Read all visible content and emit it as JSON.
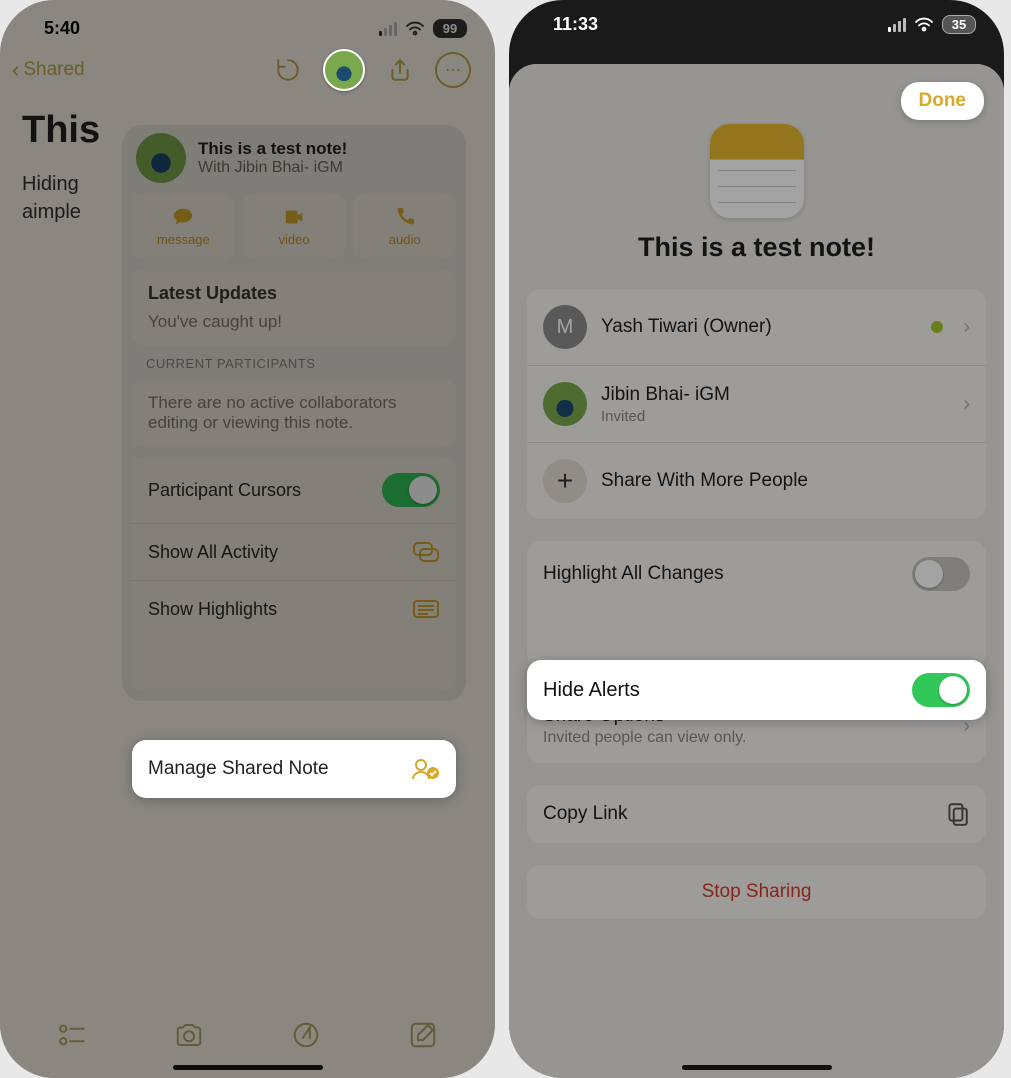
{
  "left": {
    "status": {
      "time": "5:40",
      "battery": "99"
    },
    "nav": {
      "back": "Shared"
    },
    "note": {
      "title_visible": "This",
      "body_line1": "Hiding",
      "body_line2": "aimple"
    },
    "popover": {
      "title": "This is a test note!",
      "subtitle": "With Jibin Bhai- iGM",
      "comm": {
        "message": "message",
        "video": "video",
        "audio": "audio"
      },
      "updates_title": "Latest Updates",
      "updates_body": "You've caught up!",
      "participants_label": "CURRENT PARTICIPANTS",
      "participants_body": "There are no active collaborators editing or viewing this note.",
      "rows": {
        "cursors": "Participant Cursors",
        "activity": "Show All Activity",
        "highlights": "Show Highlights",
        "manage": "Manage Shared Note"
      }
    }
  },
  "right": {
    "status": {
      "time": "11:33",
      "battery": "35"
    },
    "done": "Done",
    "title": "This is a test note!",
    "people": {
      "owner": {
        "initial": "M",
        "name": "Yash Tiwari (Owner)"
      },
      "invitee": {
        "name": "Jibin Bhai- iGM",
        "status": "Invited"
      },
      "share_more": "Share With More People"
    },
    "options": {
      "highlight": "Highlight All Changes",
      "hide_alerts": "Hide Alerts",
      "share_options": "Share Options",
      "share_options_sub": "Invited people can view only.",
      "copy_link": "Copy Link",
      "stop_sharing": "Stop Sharing"
    }
  }
}
